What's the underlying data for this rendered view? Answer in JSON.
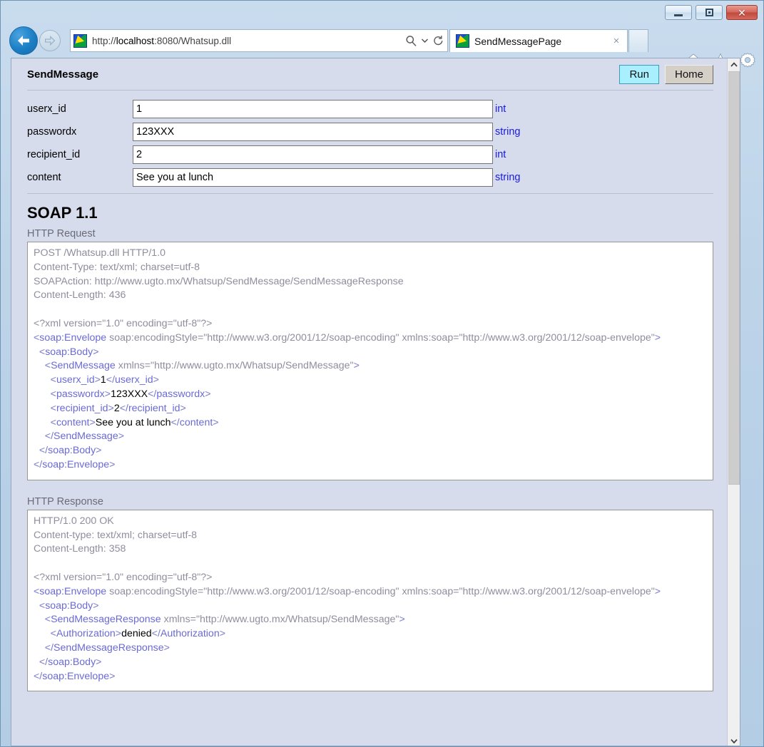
{
  "window": {
    "controls": {
      "minimize": "minimize-button",
      "restore": "restore-button",
      "close": "close-button"
    }
  },
  "browser": {
    "url_prefix": "http://",
    "url_host": "localhost",
    "url_rest": ":8080/Whatsup.dll",
    "url_full": "http://localhost:8080/Whatsup.dll",
    "tab_title": "SendMessagePage",
    "tab_close": "×",
    "icons": {
      "back": "back-arrow-icon",
      "forward": "forward-arrow-icon",
      "search": "search-icon",
      "search_caret": "chevron-down-icon",
      "refresh": "refresh-icon",
      "home": "home-icon",
      "favorites": "star-icon",
      "settings": "gear-icon"
    }
  },
  "page": {
    "operation_name": "SendMessage",
    "buttons": {
      "run": "Run",
      "home": "Home"
    },
    "parameters": [
      {
        "name": "userx_id",
        "value": "1",
        "type": "int"
      },
      {
        "name": "passwordx",
        "value": "123XXX",
        "type": "string"
      },
      {
        "name": "recipient_id",
        "value": "2",
        "type": "int"
      },
      {
        "name": "content",
        "value": "See you at lunch",
        "type": "string"
      }
    ],
    "soap_heading": "SOAP 1.1",
    "request_label": "HTTP Request",
    "response_label": "HTTP Response",
    "request": {
      "headers": [
        "POST /Whatsup.dll HTTP/1.0",
        "Content-Type: text/xml; charset=utf-8",
        "SOAPAction: http://www.ugto.mx/Whatsup/SendMessage/SendMessageResponse",
        "Content-Length: 436"
      ],
      "xml_decl": "<?xml version=\"1.0\" encoding=\"utf-8\"?>",
      "envelope_open_tag": "soap:Envelope",
      "envelope_attrs": " soap:encodingStyle=\"http://www.w3.org/2001/12/soap-encoding\" xmlns:soap=\"http://www.w3.org/2001/12/soap-envelope\"",
      "body_tag": "soap:Body",
      "method_tag": "SendMessage",
      "method_attrs": " xmlns=\"http://www.ugto.mx/Whatsup/SendMessage\"",
      "elements": [
        {
          "tag": "userx_id",
          "value": "1"
        },
        {
          "tag": "passwordx",
          "value": "123XXX"
        },
        {
          "tag": "recipient_id",
          "value": "2"
        },
        {
          "tag": "content",
          "value": "See you at lunch"
        }
      ]
    },
    "response": {
      "headers": [
        "HTTP/1.0 200 OK",
        "Content-type: text/xml; charset=utf-8",
        "Content-Length: 358"
      ],
      "xml_decl": "<?xml version=\"1.0\" encoding=\"utf-8\"?>",
      "envelope_open_tag": "soap:Envelope",
      "envelope_attrs": " soap:encodingStyle=\"http://www.w3.org/2001/12/soap-encoding\" xmlns:soap=\"http://www.w3.org/2001/12/soap-envelope\"",
      "body_tag": "soap:Body",
      "method_tag": "SendMessageResponse",
      "method_attrs": " xmlns=\"http://www.ugto.mx/Whatsup/SendMessage\"",
      "elements": [
        {
          "tag": "Authorization",
          "value": "denied"
        }
      ]
    }
  },
  "colors": {
    "page_bg": "#d7dcec",
    "run_button_bg": "#a8efff",
    "home_button_bg": "#d4d0c8",
    "type_link": "#1a1ae0",
    "xml_tag": "#6a6ad8",
    "code_grey": "#8e8e9e"
  }
}
